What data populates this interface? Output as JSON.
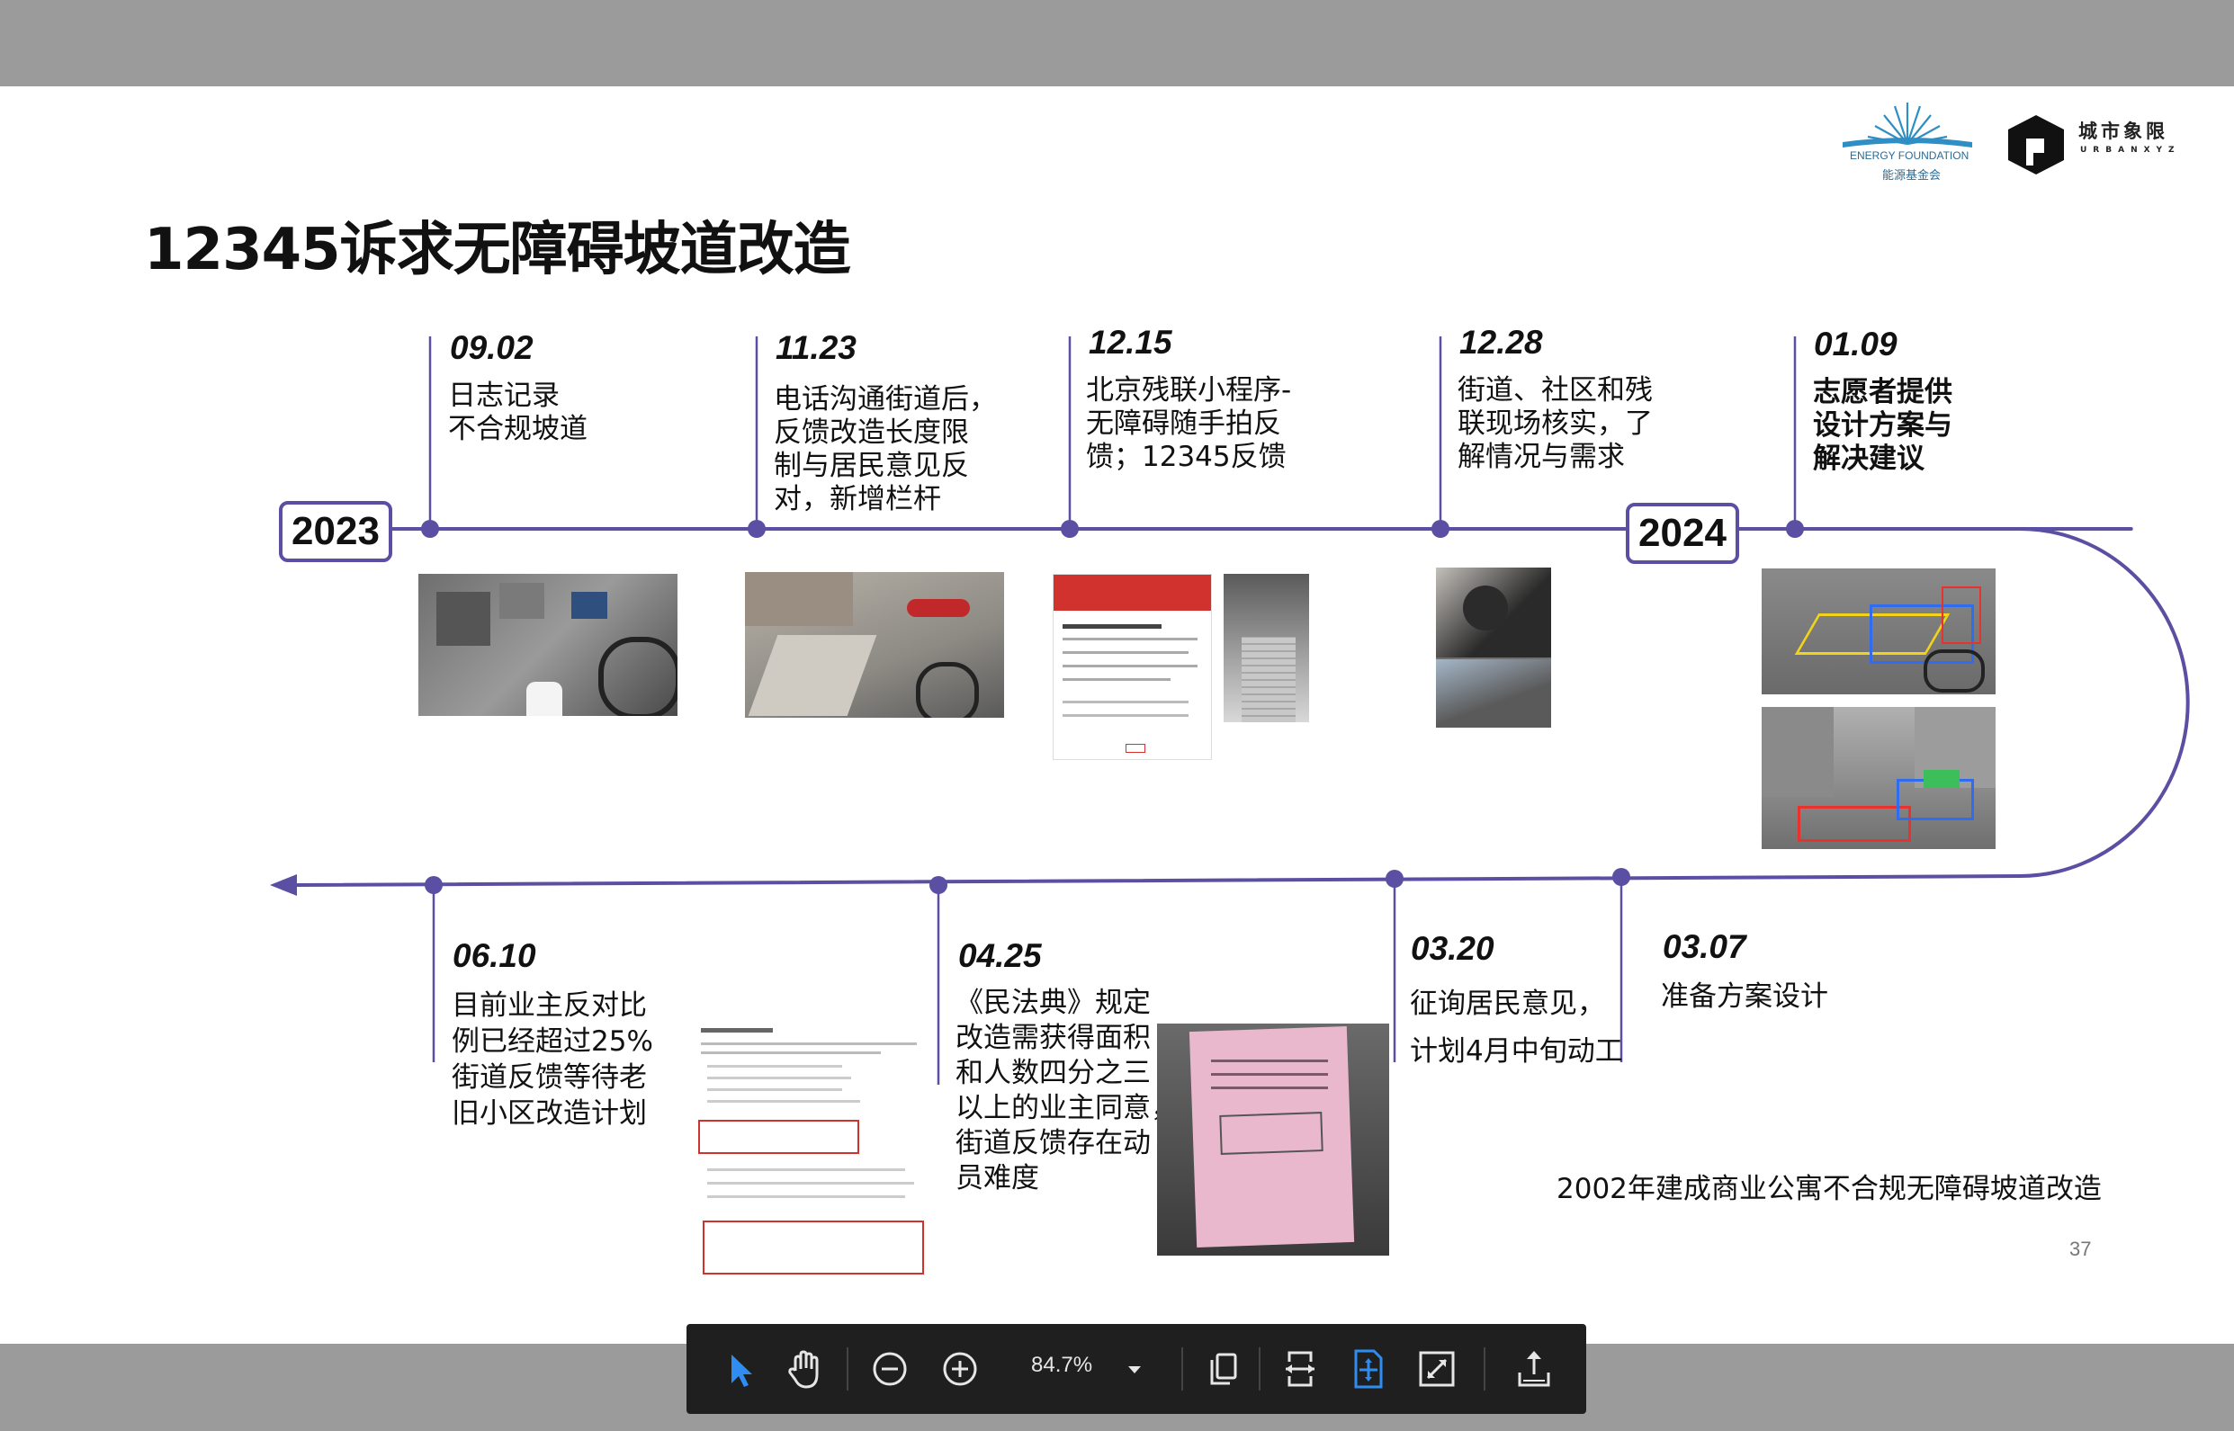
{
  "slide": {
    "title": "12345诉求无障碍坡道改造",
    "page_number": "37",
    "caption": "2002年建成商业公寓不合规无障碍坡道改造"
  },
  "logos": {
    "energy_foundation": {
      "en": "ENERGY FOUNDATION",
      "cn": "能源基金会"
    },
    "urbanxyz": {
      "cn": "城市象限",
      "en": "URBANXYZ"
    }
  },
  "years": [
    "2023",
    "2024"
  ],
  "events": [
    {
      "date": "09.02",
      "text": "日志记录\n不合规坡道"
    },
    {
      "date": "11.23",
      "text": "电话沟通街道后，\n反馈改造长度限\n制与居民意见反\n对，新增栏杆"
    },
    {
      "date": "12.15",
      "text": "北京残联小程序-\n无障碍随手拍反\n馈；12345反馈"
    },
    {
      "date": "12.28",
      "text": "街道、社区和残\n联现场核实，了\n解情况与需求"
    },
    {
      "date": "01.09",
      "text": "志愿者提供\n设计方案与\n解决建议"
    },
    {
      "date": "03.07",
      "text": "准备方案设计"
    },
    {
      "date": "03.20",
      "text": "征询居民意见，\n计划4月中旬动工"
    },
    {
      "date": "04.25",
      "text": "《民法典》规定\n改造需获得面积\n和人数四分之三\n以上的业主同意，\n街道反馈存在动\n员难度"
    },
    {
      "date": "06.10",
      "text": "目前业主反对比\n例已经超过25%\n街道反馈等待老\n旧小区改造计划"
    }
  ],
  "colors": {
    "timeline": "#5a4fa2",
    "toolbar_bg": "#1f1f1f",
    "active_icon": "#2f8cf0"
  },
  "toolbar": {
    "zoom": "84.7%",
    "icons": [
      "cursor-icon",
      "hand-icon",
      "zoom-out-icon",
      "zoom-in-icon",
      "zoom-dropdown-icon",
      "copy-icon",
      "fit-width-icon",
      "fit-page-icon",
      "fullscreen-icon",
      "share-icon"
    ]
  }
}
